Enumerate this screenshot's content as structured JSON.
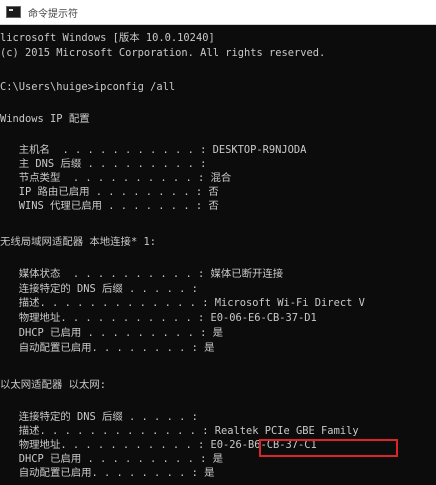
{
  "window": {
    "title": "命令提示符"
  },
  "console": {
    "lines": [
      "licrosoft Windows [版本 10.0.10240]",
      "(c) 2015 Microsoft Corporation. All rights reserved.",
      "",
      "C:\\Users\\huige>ipconfig /all",
      "",
      "Windows IP 配置",
      "",
      "   主机名  . . . . . . . . . . . : DESKTOP-R9NJODA",
      "   主 DNS 后缀 . . . . . . . . . :",
      "   节点类型  . . . . . . . . . . : 混合",
      "   IP 路由已启用 . . . . . . . . : 否",
      "   WINS 代理已启用 . . . . . . . : 否",
      "",
      "无线局域网适配器 本地连接* 1:",
      "",
      "   媒体状态  . . . . . . . . . . : 媒体已断开连接",
      "   连接特定的 DNS 后缀 . . . . . :",
      "   描述. . . . . . . . . . . . . : Microsoft Wi-Fi Direct V",
      "   物理地址. . . . . . . . . . . : E0-06-E6-CB-37-D1",
      "   DHCP 已启用 . . . . . . . . . : 是",
      "   自动配置已启用. . . . . . . . : 是",
      "",
      "以太网适配器 以太网:",
      "",
      "   连接特定的 DNS 后缀 . . . . . :",
      "   描述. . . . . . . . . . . . . : Realtek PCIe GBE Family",
      "   物理地址. . . . . . . . . . . : E0-26-B6-CB-37-C1",
      "   DHCP 已启用 . . . . . . . . . : 是",
      "   自动配置已启用. . . . . . . . : 是"
    ]
  },
  "highlight": {
    "value": "E0-26-B6-CB-37-C1",
    "color": "#d8262b"
  }
}
